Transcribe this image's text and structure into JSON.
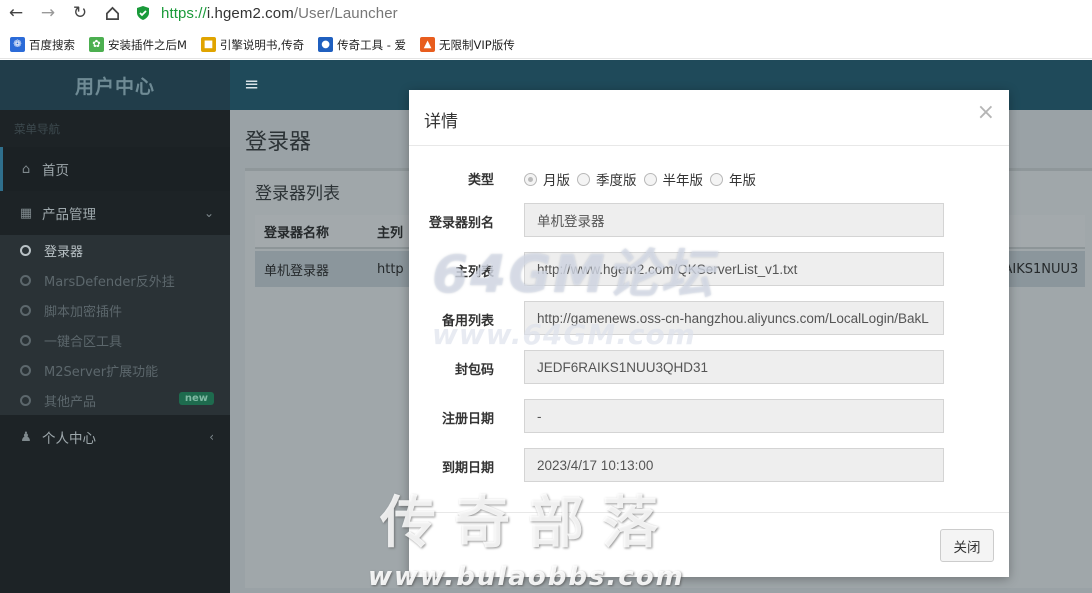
{
  "browser": {
    "url_protocol": "https://",
    "url_host": "i.hgem2.com",
    "url_path": "/User/Launcher",
    "bookmarks": [
      {
        "label": "百度搜索",
        "icon": "paw-icon",
        "color": "#2b6bd8"
      },
      {
        "label": "安装插件之后M",
        "icon": "leaf-icon",
        "color": "#4caf50"
      },
      {
        "label": "引擎说明书,传奇",
        "icon": "book-icon",
        "color": "#e0a400"
      },
      {
        "label": "传奇工具 - 爱",
        "icon": "flame-icon",
        "color": "#1f5fbf"
      },
      {
        "label": "无限制VIP版传",
        "icon": "vip-icon",
        "color": "#e85d1e"
      }
    ]
  },
  "sidebar": {
    "logo": "用户中心",
    "header": "菜单导航",
    "items": [
      {
        "label": "首页",
        "icon": "home-icon"
      },
      {
        "label": "产品管理",
        "icon": "grid-icon"
      }
    ],
    "subitems": [
      "登录器",
      "MarsDefender反外挂",
      "脚本加密插件",
      "一键合区工具",
      "M2Server扩展功能",
      "其他产品"
    ],
    "new_badge": "new",
    "personal": "个人中心"
  },
  "page": {
    "title": "登录器",
    "box_title": "登录器列表",
    "table": {
      "headers": [
        "登录器名称",
        "主列"
      ],
      "rows": [
        {
          "name": "单机登录器",
          "url": "http",
          "code": "RAIKS1NUU3"
        }
      ]
    }
  },
  "modal": {
    "title": "详情",
    "close_x": "×",
    "type_label": "类型",
    "type_options": [
      "月版",
      "季度版",
      "半年版",
      "年版"
    ],
    "type_selected": 0,
    "fields": [
      {
        "label": "登录器别名",
        "value": "单机登录器"
      },
      {
        "label": "主列表",
        "value": "http://www.hgem2.com/QKServerList_v1.txt"
      },
      {
        "label": "备用列表",
        "value": "http://gamenews.oss-cn-hangzhou.aliyuncs.com/LocalLogin/BakL"
      },
      {
        "label": "封包码",
        "value": "JEDF6RAIKS1NUU3QHD31"
      },
      {
        "label": "注册日期",
        "value": "-"
      },
      {
        "label": "到期日期",
        "value": "2023/4/17 10:13:00"
      }
    ],
    "close_button": "关闭"
  },
  "watermarks": {
    "wm1": "64GM论坛",
    "wm2": "www.64GM.com",
    "wm3": "传奇部落",
    "wm4": "www.bulaobbs.com"
  }
}
